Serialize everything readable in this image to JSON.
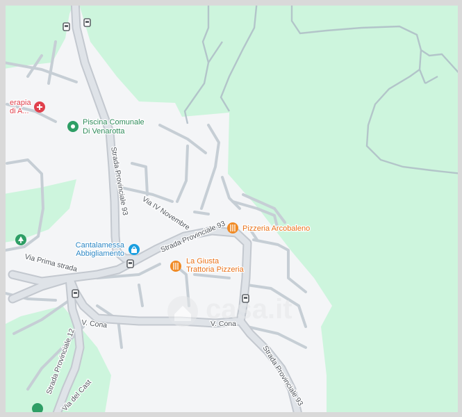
{
  "map": {
    "colors": {
      "park": "#cdf5dd",
      "land": "#f4f5f7",
      "road_fill": "#dfe3e8",
      "road_edge": "#c3c8cf",
      "minor_road": "#b8c3cb",
      "poi_green": "#2e9e65",
      "poi_green_text": "#2e8a5a",
      "poi_orange": "#f08a24",
      "poi_orange_text": "#e8711a",
      "poi_blue": "#1a9ee0",
      "poi_blue_text": "#2b86c4",
      "poi_red": "#e0404c",
      "road_text": "#50555c",
      "transit": "#5f6368"
    },
    "pois": [
      {
        "name": "Piscina Comunale",
        "name2": "Di Venarotta",
        "icon": "park-pin-icon"
      },
      {
        "name": "Pizzeria Arcobaleno",
        "icon": "restaurant-icon"
      },
      {
        "name": "La Giusta",
        "name2": "Trattoria Pizzeria",
        "icon": "restaurant-icon"
      },
      {
        "name": "Cantalamessa",
        "name2": "Abbigliamento",
        "icon": "shopping-bag-icon"
      },
      {
        "name": "erapia",
        "name2": "di A...",
        "icon": "medical-icon"
      }
    ],
    "roads": [
      {
        "name": "Strada Provinciale 93"
      },
      {
        "name": "Via IV Novembre"
      },
      {
        "name": "Strada Provinciale 93"
      },
      {
        "name": "Via Prima strada"
      },
      {
        "name": "V. Cona"
      },
      {
        "name": "V. Cona"
      },
      {
        "name": "Strada Provinciale 93"
      },
      {
        "name": "Strada Provinciale 12"
      },
      {
        "name": "Via del Cast"
      }
    ],
    "watermark": "casa.it",
    "transit_icon": "bus-stop-icon",
    "tree_icon": "tree-icon"
  }
}
